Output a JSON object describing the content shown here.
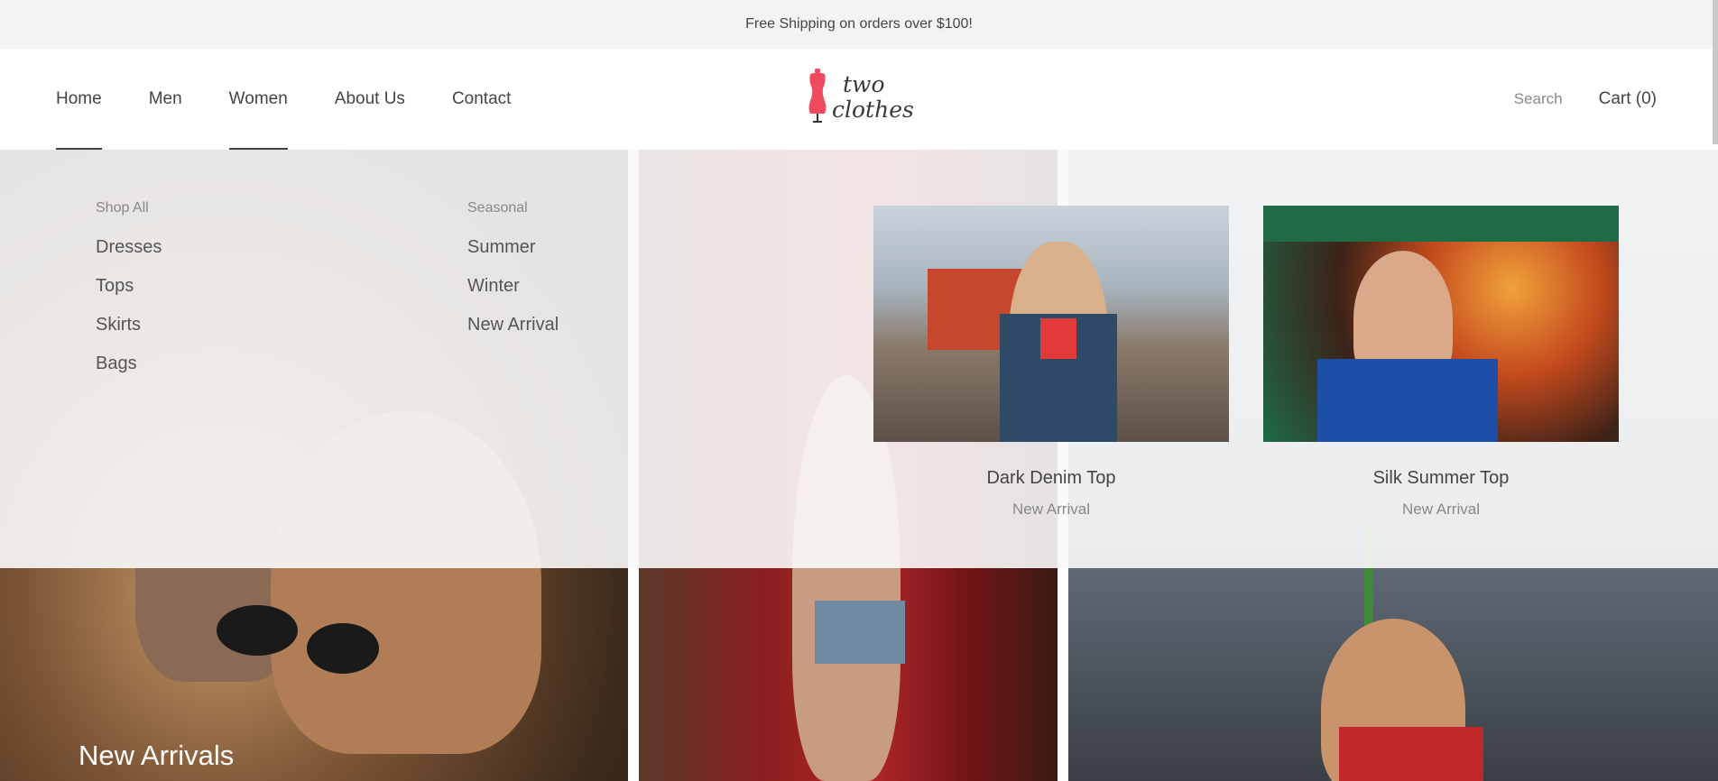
{
  "announcement": "Free Shipping on orders over $100!",
  "nav": {
    "items": [
      {
        "label": "Home"
      },
      {
        "label": "Men"
      },
      {
        "label": "Women"
      },
      {
        "label": "About Us"
      },
      {
        "label": "Contact"
      }
    ]
  },
  "logo": {
    "line1": "two",
    "line2": "clothes"
  },
  "header": {
    "search_label": "Search",
    "cart_label": "Cart (0)"
  },
  "mega_menu": {
    "columns": [
      {
        "heading": "Shop All",
        "links": [
          "Dresses",
          "Tops",
          "Skirts",
          "Bags"
        ]
      },
      {
        "heading": "Seasonal",
        "links": [
          "Summer",
          "Winter",
          "New Arrival"
        ]
      }
    ],
    "products": [
      {
        "title": "Dark Denim Top",
        "tag": "New Arrival"
      },
      {
        "title": "Silk Summer Top",
        "tag": "New Arrival"
      }
    ]
  },
  "hero": {
    "panel1_title": "New Arrivals"
  },
  "colors": {
    "accent": "#ef4a5e",
    "text": "#444444",
    "muted": "#888888"
  }
}
